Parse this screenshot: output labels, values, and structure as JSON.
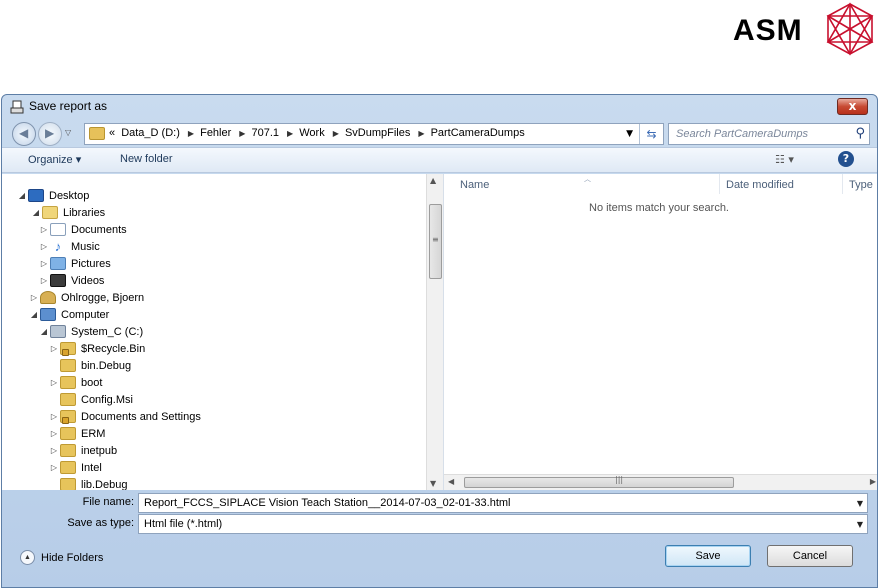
{
  "logo": {
    "text": "ASM"
  },
  "dialog": {
    "title": "Save report as",
    "close_label": "x"
  },
  "address": {
    "breadcrumbs": [
      "«",
      "Data_D (D:)",
      "Fehler",
      "707.1",
      "Work",
      "SvDumpFiles",
      "PartCameraDumps"
    ],
    "search_placeholder": "Search PartCameraDumps"
  },
  "toolbar": {
    "organize_label": "Organize ▾",
    "new_folder_label": "New folder",
    "views_icon": "views-icon",
    "help_icon": "help-icon"
  },
  "tree": {
    "items": [
      {
        "label": "Desktop",
        "icon": "desktop-icon",
        "arrow": "◢"
      },
      {
        "label": "Libraries",
        "icon": "libraries-icon",
        "arrow": "◢"
      },
      {
        "label": "Documents",
        "icon": "documents-icon",
        "arrow": "▷"
      },
      {
        "label": "Music",
        "icon": "music-icon",
        "arrow": "▷"
      },
      {
        "label": "Pictures",
        "icon": "pictures-icon",
        "arrow": "▷"
      },
      {
        "label": "Videos",
        "icon": "videos-icon",
        "arrow": "▷"
      },
      {
        "label": "Ohlrogge, Bjoern",
        "icon": "user-icon",
        "arrow": "▷"
      },
      {
        "label": "Computer",
        "icon": "computer-icon",
        "arrow": "◢"
      },
      {
        "label": "System_C (C:)",
        "icon": "drive-icon",
        "arrow": "◢"
      },
      {
        "label": "$Recycle.Bin",
        "icon": "locked-folder-icon",
        "arrow": "▷"
      },
      {
        "label": "bin.Debug",
        "icon": "folder-icon",
        "arrow": ""
      },
      {
        "label": "boot",
        "icon": "folder-icon",
        "arrow": "▷"
      },
      {
        "label": "Config.Msi",
        "icon": "folder-icon",
        "arrow": ""
      },
      {
        "label": "Documents and Settings",
        "icon": "locked-folder-icon",
        "arrow": "▷"
      },
      {
        "label": "ERM",
        "icon": "folder-icon",
        "arrow": "▷"
      },
      {
        "label": "inetpub",
        "icon": "folder-icon",
        "arrow": "▷"
      },
      {
        "label": "Intel",
        "icon": "folder-icon",
        "arrow": "▷"
      },
      {
        "label": "lib.Debug",
        "icon": "folder-icon",
        "arrow": ""
      }
    ]
  },
  "list": {
    "columns": [
      "Name",
      "Date modified",
      "Type"
    ],
    "empty_message": "No items match your search."
  },
  "form": {
    "file_name_label": "File name:",
    "file_name_value": "Report_FCCS_SIPLACE Vision Teach Station__2014-07-03_02-01-33.html",
    "save_type_label": "Save as type:",
    "save_type_value": "Html file (*.html)",
    "hide_folders_label": "Hide Folders",
    "save_label": "Save",
    "cancel_label": "Cancel"
  }
}
